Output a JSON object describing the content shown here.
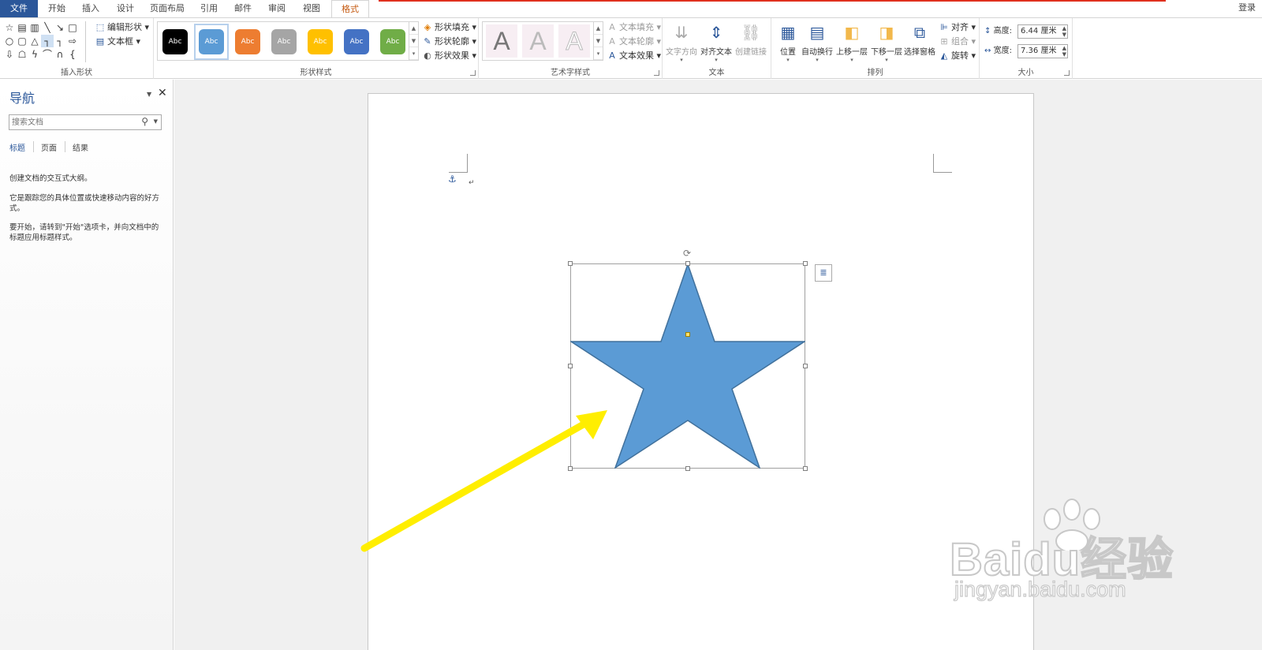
{
  "tabs": [
    "文件",
    "开始",
    "插入",
    "设计",
    "页面布局",
    "引用",
    "邮件",
    "审阅",
    "视图",
    "格式"
  ],
  "login_label": "登录",
  "ribbon": {
    "insert_shapes": {
      "label": "插入形状",
      "edit_shape": "编辑形状",
      "text_box": "文本框"
    },
    "shape_styles": {
      "label": "形状样式",
      "swatch_text": "Abc",
      "swatch_colors": [
        "#000000",
        "#5b9bd5",
        "#ed7d31",
        "#a5a5a5",
        "#ffc000",
        "#4472c4",
        "#70ad47"
      ],
      "fill": "形状填充",
      "outline": "形状轮廓",
      "effects": "形状效果"
    },
    "wordart_styles": {
      "label": "艺术字样式",
      "letter": "A",
      "text_fill": "文本填充",
      "text_outline": "文本轮廓",
      "text_effects": "文本效果"
    },
    "text": {
      "label": "文本",
      "text_direction": "文字方向",
      "align_text": "对齐文本",
      "create_link": "创建链接"
    },
    "arrange": {
      "label": "排列",
      "position": "位置",
      "wrap_text": "自动换行",
      "bring_forward": "上移一层",
      "send_backward": "下移一层",
      "selection_pane": "选择窗格",
      "align": "对齐",
      "group": "组合",
      "rotate": "旋转"
    },
    "size": {
      "label": "大小",
      "height_label": "高度:",
      "height_value": "6.44 厘米",
      "width_label": "宽度:",
      "width_value": "7.36 厘米"
    }
  },
  "nav": {
    "title": "导航",
    "search_placeholder": "搜索文档",
    "tabs": [
      "标题",
      "页面",
      "结果"
    ],
    "paragraphs": [
      "创建文档的交互式大纲。",
      "它是跟踪您的具体位置或快速移动内容的好方式。",
      "要开始，请转到\"开始\"选项卡，并向文档中的标题应用标题样式。"
    ]
  },
  "document": {
    "star_fill": "#5b9bd5",
    "star_stroke": "#41719c",
    "arrow_color": "#ffee00"
  },
  "watermark": {
    "brand": "Baidu经验",
    "url": "jingyan.baidu.com"
  }
}
